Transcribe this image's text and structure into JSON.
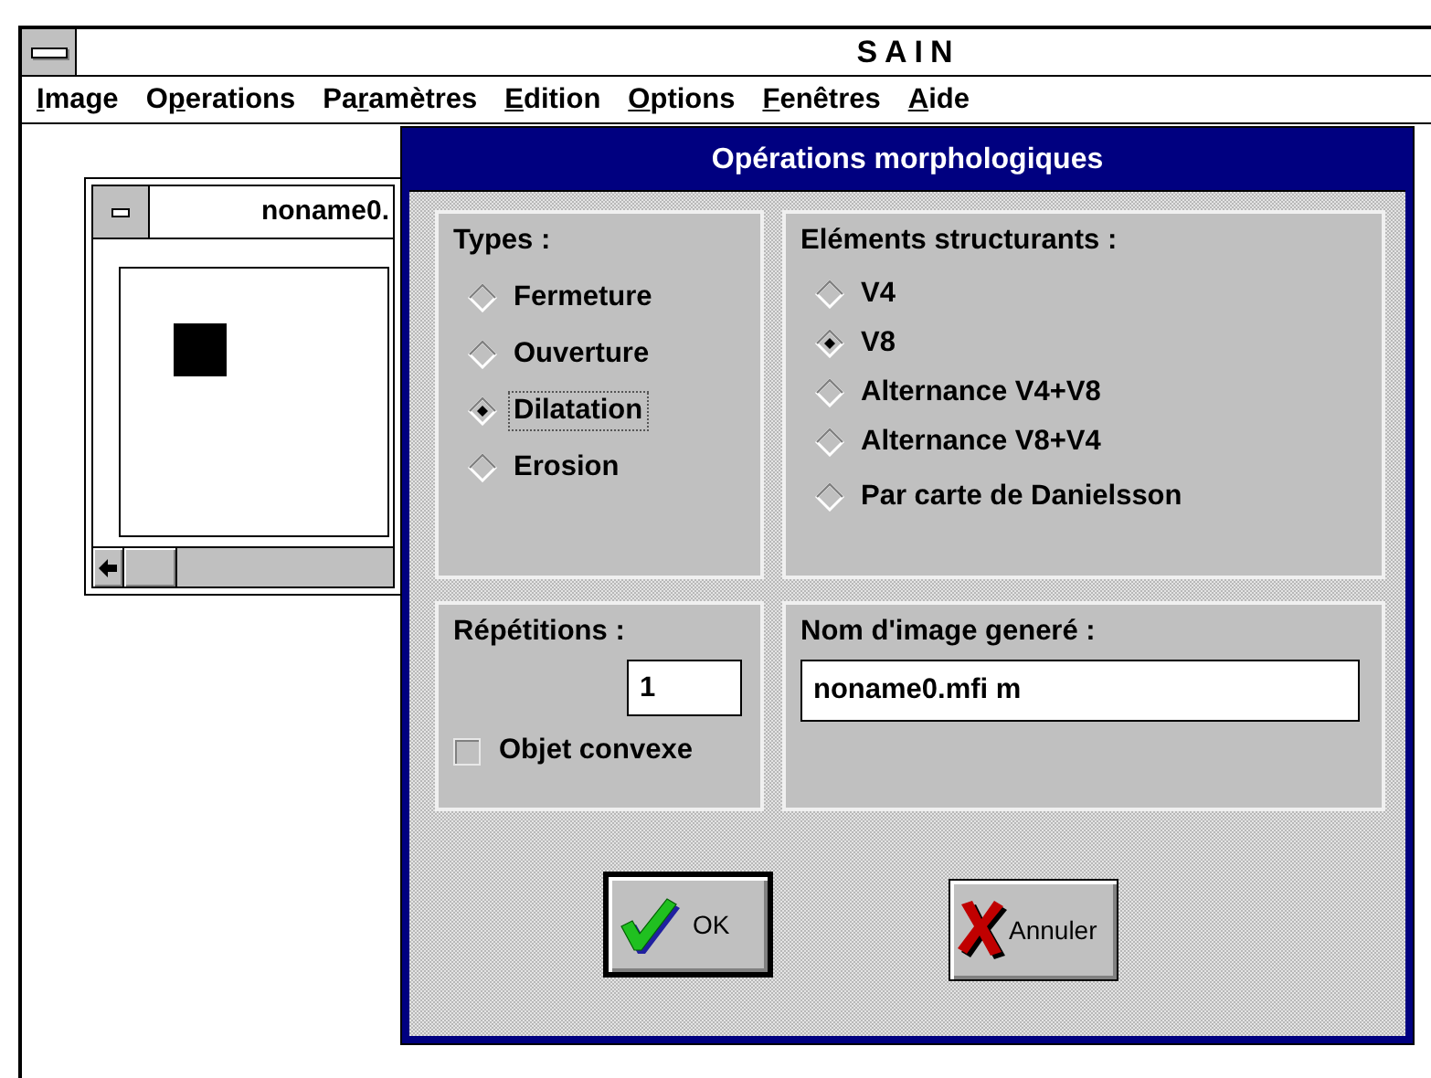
{
  "window": {
    "title": "SAIN"
  },
  "menu": [
    {
      "key": "I",
      "post": "mage"
    },
    {
      "pre": "O",
      "key": "p",
      "post": "erations"
    },
    {
      "pre": "Pa",
      "key": "r",
      "post": "amètres"
    },
    {
      "key": "E",
      "post": "dition"
    },
    {
      "key": "O",
      "post": "ptions"
    },
    {
      "key": "F",
      "post": "enêtres"
    },
    {
      "key": "A",
      "post": "ide"
    }
  ],
  "document_window": {
    "title": "noname0."
  },
  "dialog": {
    "title": "Opérations morphologiques",
    "types": {
      "label": "Types :",
      "options": [
        {
          "label": "Fermeture",
          "selected": false,
          "focused": false
        },
        {
          "label": "Ouverture",
          "selected": false,
          "focused": false
        },
        {
          "label": "Dilatation",
          "selected": true,
          "focused": true
        },
        {
          "label": "Erosion",
          "selected": false,
          "focused": false
        }
      ]
    },
    "structuring_elements": {
      "label": "Eléments structurants :",
      "options": [
        {
          "label": "V4",
          "selected": false
        },
        {
          "label": "V8",
          "selected": true
        },
        {
          "label": "Alternance V4+V8",
          "selected": false
        },
        {
          "label": "Alternance V8+V4",
          "selected": false
        },
        {
          "label": "Par carte de Danielsson",
          "selected": false
        }
      ]
    },
    "repetitions": {
      "label": "Répétitions :",
      "value": "1"
    },
    "convex_object": {
      "label": "Objet convexe",
      "checked": false
    },
    "output_name": {
      "label": "Nom d'image generé :",
      "value": "noname0.mfi m"
    },
    "buttons": [
      {
        "kind": "ok",
        "label": "OK",
        "default": true
      },
      {
        "kind": "cancel",
        "label": "Annuler",
        "default": false
      }
    ]
  }
}
